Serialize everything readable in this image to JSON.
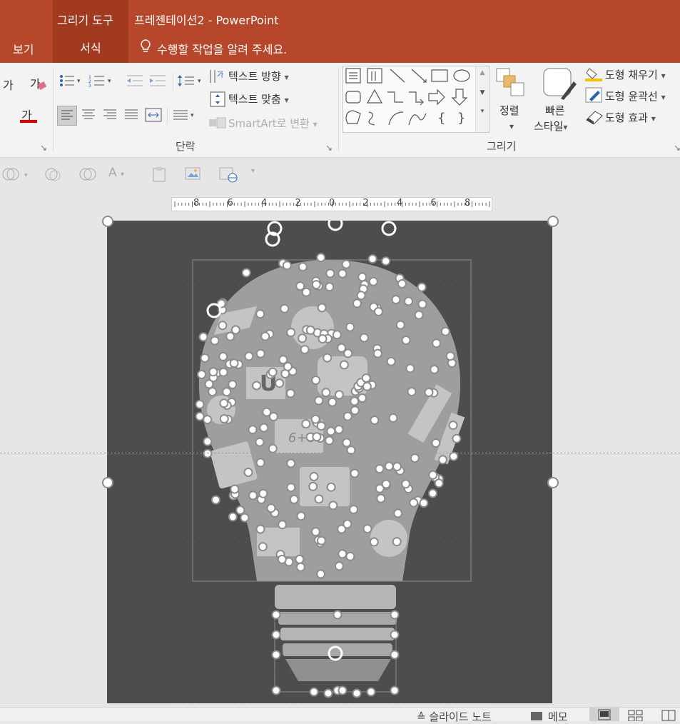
{
  "titlebar": {
    "context_group": "그리기 도구",
    "doc_title": "프레젠테이션2 - PowerPoint"
  },
  "tabs": {
    "view": "보기",
    "format": "서식",
    "tell_me": "수행할 작업을 알려 주세요."
  },
  "ribbon": {
    "paragraph": {
      "group_label": "단락",
      "text_direction": "텍스트 방향",
      "align_text": "텍스트 맞춤",
      "smartart": "SmartArt로 변환"
    },
    "drawing": {
      "group_label": "그리기",
      "arrange": "정렬",
      "quick_styles_line1": "빠른",
      "quick_styles_line2": "스타일",
      "shape_fill": "도형 채우기",
      "shape_outline": "도형 윤곽선",
      "shape_effects": "도형 효과"
    },
    "font": {
      "sample1": "가",
      "sample2": "가",
      "font_color": "가"
    }
  },
  "ruler": {
    "labels": [
      "8",
      "6",
      "4",
      "2",
      "0",
      "2",
      "4",
      "6",
      "8"
    ]
  },
  "statusbar": {
    "notes": "슬라이드 노트",
    "comments": "메모"
  },
  "colors": {
    "title_bar": "#b7472a",
    "context_group": "#a23a1f",
    "slide_bg": "#4d4d4d",
    "font_color_bar": "#e00000",
    "fill_bar": "#f5c000"
  }
}
